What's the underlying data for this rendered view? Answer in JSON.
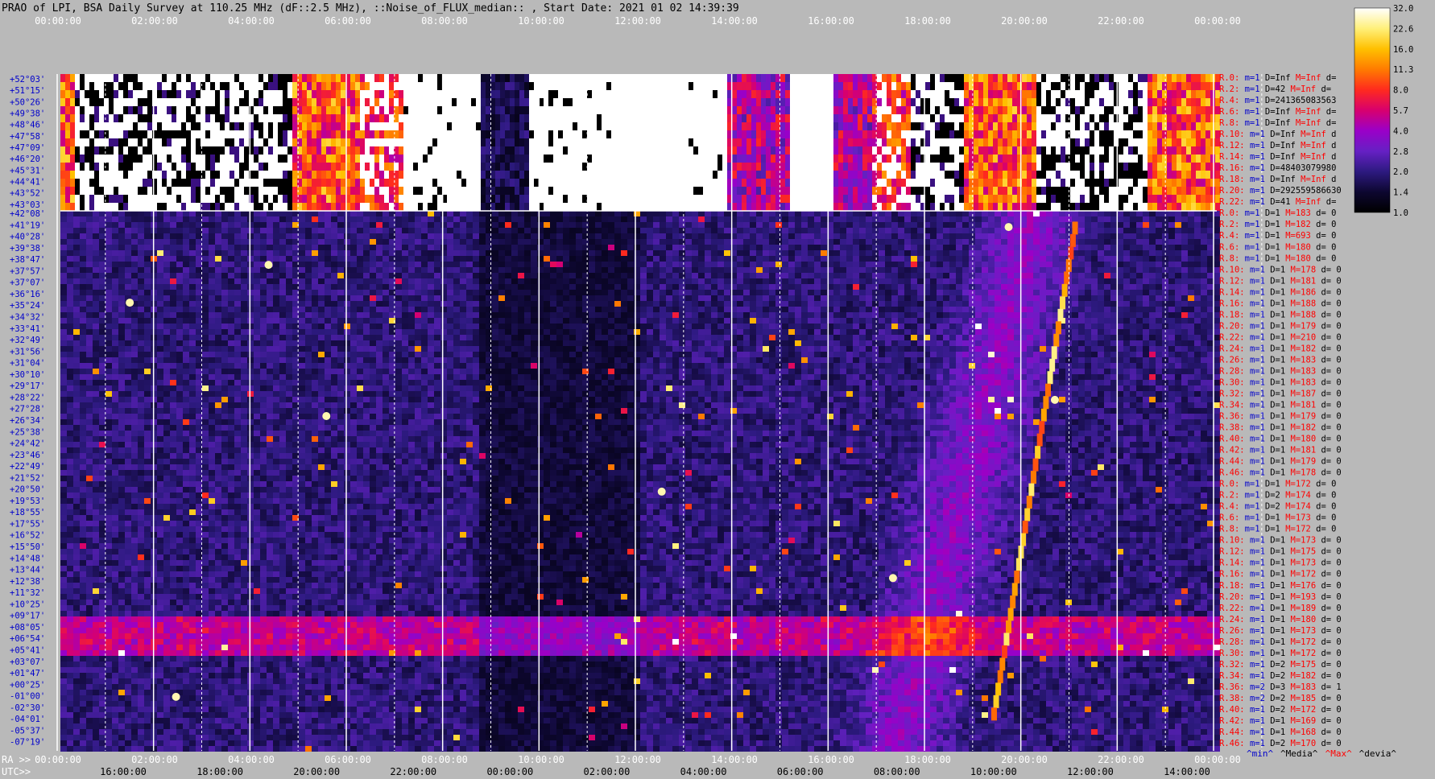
{
  "title": "PRAO of LPI, BSA Daily Survey at 110.25 MHz (dF::2.5 MHz), ::Noise_of_FLUX_median:: , Start Date: 2021 01 02 14:39:39",
  "chart_data": {
    "type": "heatmap",
    "title": "PRAO of LPI, BSA Daily Survey at 110.25 MHz (dF::2.5 MHz), ::Noise_of_FLUX_median:: , Start Date: 2021 01 02 14:39:39",
    "top_axis_ticks": [
      "00:00:00",
      "02:00:00",
      "04:00:00",
      "06:00:00",
      "08:00:00",
      "10:00:00",
      "12:00:00",
      "14:00:00",
      "16:00:00",
      "18:00:00",
      "20:00:00",
      "22:00:00",
      "00:00:00"
    ],
    "ra_axis_label": "RA >>",
    "ra_axis_ticks": [
      "00:00:00",
      "02:00:00",
      "04:00:00",
      "06:00:00",
      "08:00:00",
      "10:00:00",
      "12:00:00",
      "14:00:00",
      "16:00:00",
      "18:00:00",
      "20:00:00",
      "22:00:00",
      "00:00:00"
    ],
    "utc_axis_label": "UTC>>",
    "utc_axis_ticks": [
      "16:00:00",
      "18:00:00",
      "20:00:00",
      "22:00:00",
      "00:00:00",
      "02:00:00",
      "04:00:00",
      "06:00:00",
      "08:00:00",
      "10:00:00",
      "12:00:00",
      "14:00:00"
    ],
    "dec_labels_upper": [
      "+52°03'",
      "+51°15'",
      "+50°26'",
      "+49°38'",
      "+48°46'",
      "+47°58'",
      "+47°09'",
      "+46°20'",
      "+45°31'",
      "+44°41'",
      "+43°52'",
      "+43°03'"
    ],
    "dec_labels_lower": [
      "+42°08'",
      "+41°19'",
      "+40°28'",
      "+39°38'",
      "+38°47'",
      "+37°57'",
      "+37°07'",
      "+36°16'",
      "+35°24'",
      "+34°32'",
      "+33°41'",
      "+32°49'",
      "+31°56'",
      "+31°04'",
      "+30°10'",
      "+29°17'",
      "+28°22'",
      "+27°28'",
      "+26°34'",
      "+25°38'",
      "+24°42'",
      "+23°46'",
      "+22°49'",
      "+21°52'",
      "+20°50'",
      "+19°53'",
      "+18°55'",
      "+17°55'",
      "+16°52'",
      "+15°50'",
      "+14°48'",
      "+13°44'",
      "+12°38'",
      "+11°32'",
      "+10°25'",
      "+09°17'",
      "+08°05'",
      "+06°54'",
      "+05°41'",
      "+03°07'",
      "+01°47'",
      "+00°25'",
      "-01°00'",
      "-02°30'",
      "-04°01'",
      "-05°37'",
      "-07°19'"
    ],
    "colorbar": {
      "ticks": [
        "32.0",
        "22.6",
        "16.0",
        "11.3",
        "8.0",
        "5.7",
        "4.0",
        "2.8",
        "2.0",
        "1.4",
        "1.0"
      ],
      "colors": [
        "#ffffff",
        "#fff07a",
        "#ffc000",
        "#ff7b00",
        "#ff2a1e",
        "#d8006e",
        "#9a00c8",
        "#6620c4",
        "#2d1a80",
        "#0d0730",
        "#000000"
      ]
    },
    "right_stats": [
      {
        "r": "R.0:",
        "m": "m=1",
        "d": "D=Inf",
        "M": "M=Inf",
        "dv": "d="
      },
      {
        "r": "R.2:",
        "m": "m=1",
        "d": "D=42",
        "M": "M=Inf",
        "dv": "d="
      },
      {
        "r": "R.4:",
        "m": "m=1",
        "d": "D=241365083563",
        "M": "",
        "dv": ""
      },
      {
        "r": "R.6:",
        "m": "m=1",
        "d": "D=Inf",
        "M": "M=Inf",
        "dv": "d="
      },
      {
        "r": "R.8:",
        "m": "m=1",
        "d": "D=Inf",
        "M": "M=Inf",
        "dv": "d="
      },
      {
        "r": "R.10:",
        "m": "m=1",
        "d": "D=Inf",
        "M": "M=Inf",
        "dv": "d"
      },
      {
        "r": "R.12:",
        "m": "m=1",
        "d": "D=Inf",
        "M": "M=Inf",
        "dv": "d"
      },
      {
        "r": "R.14:",
        "m": "m=1",
        "d": "D=Inf",
        "M": "M=Inf",
        "dv": "d"
      },
      {
        "r": "R.16:",
        "m": "m=1",
        "d": "D=48403079980",
        "M": "",
        "dv": ""
      },
      {
        "r": "R.18:",
        "m": "m=1",
        "d": "D=Inf",
        "M": "M=Inf",
        "dv": "d"
      },
      {
        "r": "R.20:",
        "m": "m=1",
        "d": "D=292559586630",
        "M": "",
        "dv": ""
      },
      {
        "r": "R.22:",
        "m": "m=1",
        "d": "D=41",
        "M": "M=Inf",
        "dv": "d="
      },
      {
        "r": "R.0:",
        "m": "m=1",
        "d": "D=1",
        "M": "M=183",
        "dv": "d= 0"
      },
      {
        "r": "R.2:",
        "m": "m=1",
        "d": "D=1",
        "M": "M=182",
        "dv": "d= 0"
      },
      {
        "r": "R.4:",
        "m": "m=1",
        "d": "D=1",
        "M": "M=693",
        "dv": "d= 0"
      },
      {
        "r": "R.6:",
        "m": "m=1",
        "d": "D=1",
        "M": "M=180",
        "dv": "d= 0"
      },
      {
        "r": "R.8:",
        "m": "m=1",
        "d": "D=1",
        "M": "M=180",
        "dv": "d= 0"
      },
      {
        "r": "R.10:",
        "m": "m=1",
        "d": "D=1",
        "M": "M=178",
        "dv": "d= 0"
      },
      {
        "r": "R.12:",
        "m": "m=1",
        "d": "D=1",
        "M": "M=181",
        "dv": "d= 0"
      },
      {
        "r": "R.14:",
        "m": "m=1",
        "d": "D=1",
        "M": "M=186",
        "dv": "d= 0"
      },
      {
        "r": "R.16:",
        "m": "m=1",
        "d": "D=1",
        "M": "M=188",
        "dv": "d= 0"
      },
      {
        "r": "R.18:",
        "m": "m=1",
        "d": "D=1",
        "M": "M=188",
        "dv": "d= 0"
      },
      {
        "r": "R.20:",
        "m": "m=1",
        "d": "D=1",
        "M": "M=179",
        "dv": "d= 0"
      },
      {
        "r": "R.22:",
        "m": "m=1",
        "d": "D=1",
        "M": "M=210",
        "dv": "d= 0"
      },
      {
        "r": "R.24:",
        "m": "m=1",
        "d": "D=1",
        "M": "M=182",
        "dv": "d= 0"
      },
      {
        "r": "R.26:",
        "m": "m=1",
        "d": "D=1",
        "M": "M=183",
        "dv": "d= 0"
      },
      {
        "r": "R.28:",
        "m": "m=1",
        "d": "D=1",
        "M": "M=183",
        "dv": "d= 0"
      },
      {
        "r": "R.30:",
        "m": "m=1",
        "d": "D=1",
        "M": "M=183",
        "dv": "d= 0"
      },
      {
        "r": "R.32:",
        "m": "m=1",
        "d": "D=1",
        "M": "M=187",
        "dv": "d= 0"
      },
      {
        "r": "R.34:",
        "m": "m=1",
        "d": "D=1",
        "M": "M=181",
        "dv": "d= 0"
      },
      {
        "r": "R.36:",
        "m": "m=1",
        "d": "D=1",
        "M": "M=179",
        "dv": "d= 0"
      },
      {
        "r": "R.38:",
        "m": "m=1",
        "d": "D=1",
        "M": "M=182",
        "dv": "d= 0"
      },
      {
        "r": "R.40:",
        "m": "m=1",
        "d": "D=1",
        "M": "M=180",
        "dv": "d= 0"
      },
      {
        "r": "R.42:",
        "m": "m=1",
        "d": "D=1",
        "M": "M=181",
        "dv": "d= 0"
      },
      {
        "r": "R.44:",
        "m": "m=1",
        "d": "D=1",
        "M": "M=179",
        "dv": "d= 0"
      },
      {
        "r": "R.46:",
        "m": "m=1",
        "d": "D=1",
        "M": "M=178",
        "dv": "d= 0"
      },
      {
        "r": "R.0:",
        "m": "m=1",
        "d": "D=1",
        "M": "M=172",
        "dv": "d= 0"
      },
      {
        "r": "R.2:",
        "m": "m=1",
        "d": "D=2",
        "M": "M=174",
        "dv": "d= 0"
      },
      {
        "r": "R.4:",
        "m": "m=1",
        "d": "D=2",
        "M": "M=174",
        "dv": "d= 0"
      },
      {
        "r": "R.6:",
        "m": "m=1",
        "d": "D=1",
        "M": "M=173",
        "dv": "d= 0"
      },
      {
        "r": "R.8:",
        "m": "m=1",
        "d": "D=1",
        "M": "M=172",
        "dv": "d= 0"
      },
      {
        "r": "R.10:",
        "m": "m=1",
        "d": "D=1",
        "M": "M=173",
        "dv": "d= 0"
      },
      {
        "r": "R.12:",
        "m": "m=1",
        "d": "D=1",
        "M": "M=175",
        "dv": "d= 0"
      },
      {
        "r": "R.14:",
        "m": "m=1",
        "d": "D=1",
        "M": "M=173",
        "dv": "d= 0"
      },
      {
        "r": "R.16:",
        "m": "m=1",
        "d": "D=1",
        "M": "M=172",
        "dv": "d= 0"
      },
      {
        "r": "R.18:",
        "m": "m=1",
        "d": "D=1",
        "M": "M=176",
        "dv": "d= 0"
      },
      {
        "r": "R.20:",
        "m": "m=1",
        "d": "D=1",
        "M": "M=193",
        "dv": "d= 0"
      },
      {
        "r": "R.22:",
        "m": "m=1",
        "d": "D=1",
        "M": "M=189",
        "dv": "d= 0"
      },
      {
        "r": "R.24:",
        "m": "m=1",
        "d": "D=1",
        "M": "M=180",
        "dv": "d= 0"
      },
      {
        "r": "R.26:",
        "m": "m=1",
        "d": "D=1",
        "M": "M=173",
        "dv": "d= 0"
      },
      {
        "r": "R.28:",
        "m": "m=1",
        "d": "D=1",
        "M": "M=172",
        "dv": "d= 0"
      },
      {
        "r": "R.30:",
        "m": "m=1",
        "d": "D=1",
        "M": "M=172",
        "dv": "d= 0"
      },
      {
        "r": "R.32:",
        "m": "m=1",
        "d": "D=2",
        "M": "M=175",
        "dv": "d= 0"
      },
      {
        "r": "R.34:",
        "m": "m=1",
        "d": "D=2",
        "M": "M=182",
        "dv": "d= 0"
      },
      {
        "r": "R.36:",
        "m": "m=2",
        "d": "D=3",
        "M": "M=183",
        "dv": "d= 1"
      },
      {
        "r": "R.38:",
        "m": "m=2",
        "d": "D=2",
        "M": "M=185",
        "dv": "d= 0"
      },
      {
        "r": "R.40:",
        "m": "m=1",
        "d": "D=2",
        "M": "M=172",
        "dv": "d= 0"
      },
      {
        "r": "R.42:",
        "m": "m=1",
        "d": "D=1",
        "M": "M=169",
        "dv": "d= 0"
      },
      {
        "r": "R.44:",
        "m": "m=1",
        "d": "D=1",
        "M": "M=168",
        "dv": "d= 0"
      },
      {
        "r": "R.46:",
        "m": "m=1",
        "d": "D=2",
        "M": "M=170",
        "dv": "d= 0"
      }
    ],
    "footer_legend": [
      {
        "text": "^min^",
        "color": "#0000cc"
      },
      {
        "text": "^Media^",
        "color": "#000000"
      },
      {
        "text": "^Max^",
        "color": "#ff0000"
      },
      {
        "text": "^devia^",
        "color": "#000000"
      }
    ],
    "colors": {
      "background": "#b9b9b9",
      "stats_red": "#ff0000",
      "stats_blue": "#0000cc",
      "dec_blue": "#0000cc",
      "axis_text": "#ffffff",
      "axis_text_dark": "#000000"
    }
  }
}
